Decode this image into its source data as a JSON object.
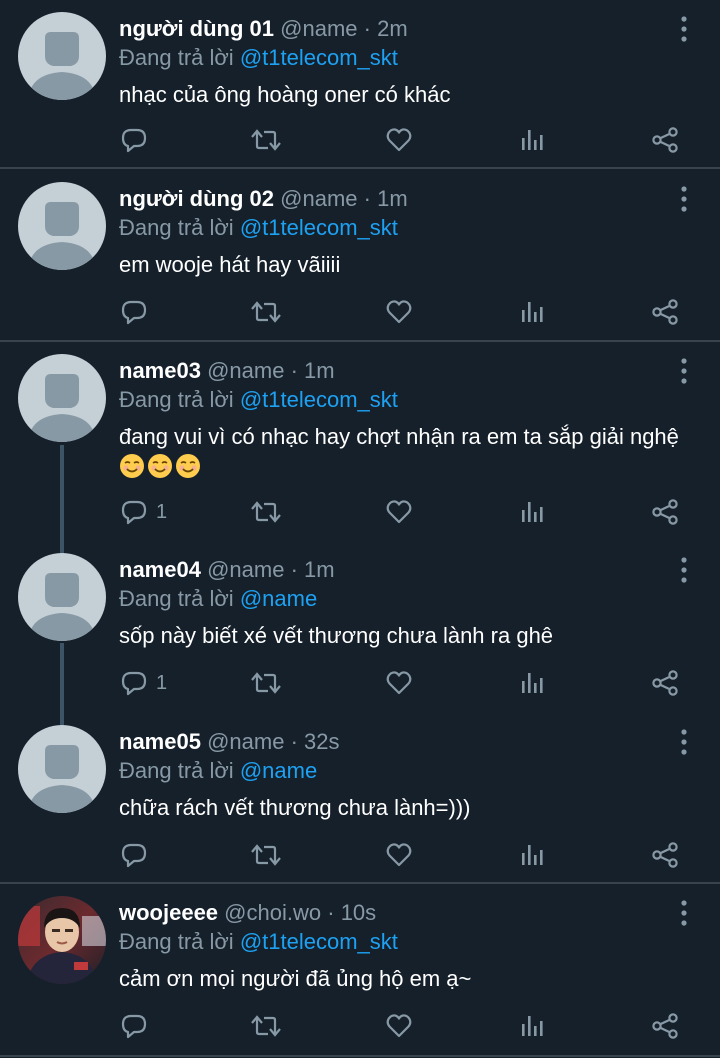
{
  "colors": {
    "background": "#15202b",
    "separator": "#38444d",
    "secondary_text": "#8899a6",
    "link": "#1da1f2",
    "primary_text": "#ffffff",
    "thread_line": "#3d5466"
  },
  "tweets": [
    {
      "name": "người dùng 01",
      "handle": "@name",
      "dot": "·",
      "time": "2m",
      "reply_prefix": "Đang trả lời",
      "reply_target": "@t1telecom_skt",
      "text": "nhạc của ông hoàng oner có khác",
      "reply_count": "",
      "avatar": "default-avatar-icon"
    },
    {
      "name": "người dùng 02",
      "handle": "@name",
      "dot": "·",
      "time": "1m",
      "reply_prefix": "Đang trả lời",
      "reply_target": "@t1telecom_skt",
      "text": "em wooje hát hay vãiiii",
      "reply_count": "",
      "avatar": "default-avatar-icon"
    },
    {
      "name": "name03",
      "handle": "@name",
      "dot": "·",
      "time": "1m",
      "reply_prefix": "Đang trả lời",
      "reply_target": "@t1telecom_skt",
      "text": "đang vui vì có nhạc hay chợt nhận ra em ta sắp giải nghệ",
      "emoji": "☺☺☺",
      "reply_count": "1",
      "avatar": "default-avatar-icon"
    },
    {
      "name": "name04",
      "handle": "@name",
      "dot": "·",
      "time": "1m",
      "reply_prefix": "Đang trả lời",
      "reply_target": "@name",
      "text": "sốp này biết xé vết thương chưa lành ra ghê",
      "reply_count": "1",
      "avatar": "default-avatar-icon"
    },
    {
      "name": "name05",
      "handle": "@name",
      "dot": "·",
      "time": "32s",
      "reply_prefix": "Đang trả lời",
      "reply_target": "@name",
      "text": "chữa rách vết thương chưa lành=)))",
      "reply_count": "",
      "avatar": "default-avatar-icon"
    },
    {
      "name": "woojeeee",
      "handle": "@choi.wo",
      "dot": "·",
      "time": "10s",
      "reply_prefix": "Đang trả lời",
      "reply_target": "@t1telecom_skt",
      "text": "cảm ơn mọi người đã ủng hộ em ạ~",
      "reply_count": "",
      "avatar": "profile-photo"
    }
  ],
  "icons": {
    "reply": "reply-icon",
    "retweet": "retweet-icon",
    "like": "like-icon",
    "stats": "stats-icon",
    "share": "share-icon",
    "more": "more-options-icon"
  }
}
